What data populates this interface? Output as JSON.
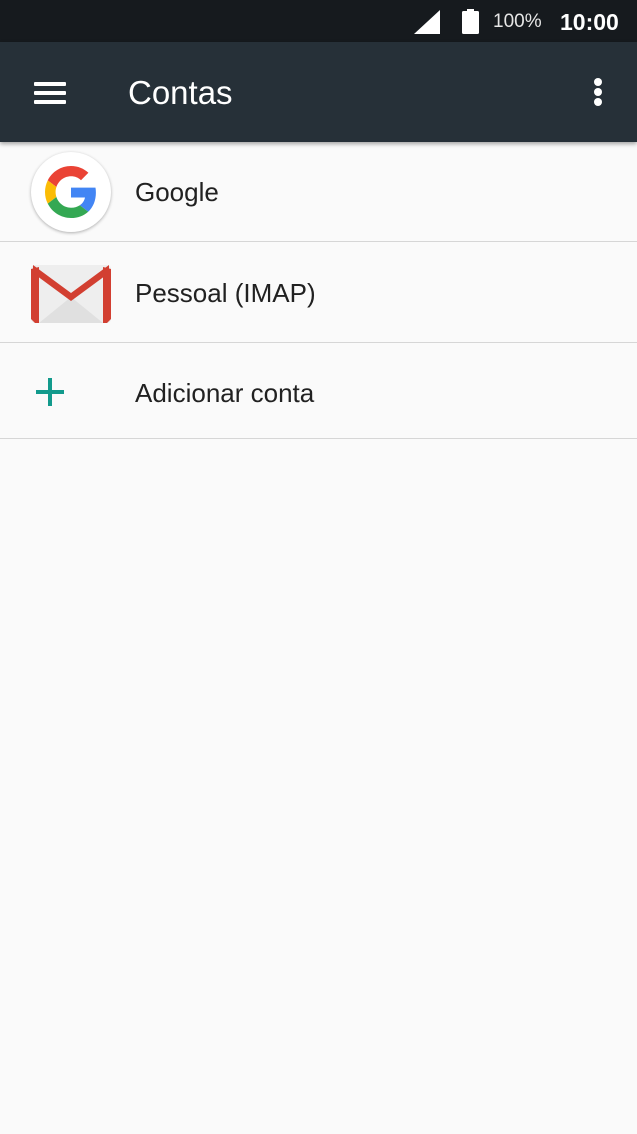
{
  "status_bar": {
    "battery_text": "100%",
    "time": "10:00",
    "icons": [
      "signal-icon",
      "battery-icon"
    ]
  },
  "app_bar": {
    "title": "Contas",
    "menu_icon": "hamburger-menu-icon",
    "overflow_icon": "more-vert-icon"
  },
  "accounts": [
    {
      "label": "Google",
      "icon": "google-logo-icon"
    },
    {
      "label": "Pessoal (IMAP)",
      "icon": "gmail-envelope-icon"
    }
  ],
  "add_account": {
    "label": "Adicionar conta",
    "icon": "plus-icon"
  },
  "colors": {
    "status_bar": "#161a1e",
    "app_bar": "#263038",
    "background": "#fafafa",
    "accent": "#129a8c",
    "divider": "#d6d6d6"
  }
}
